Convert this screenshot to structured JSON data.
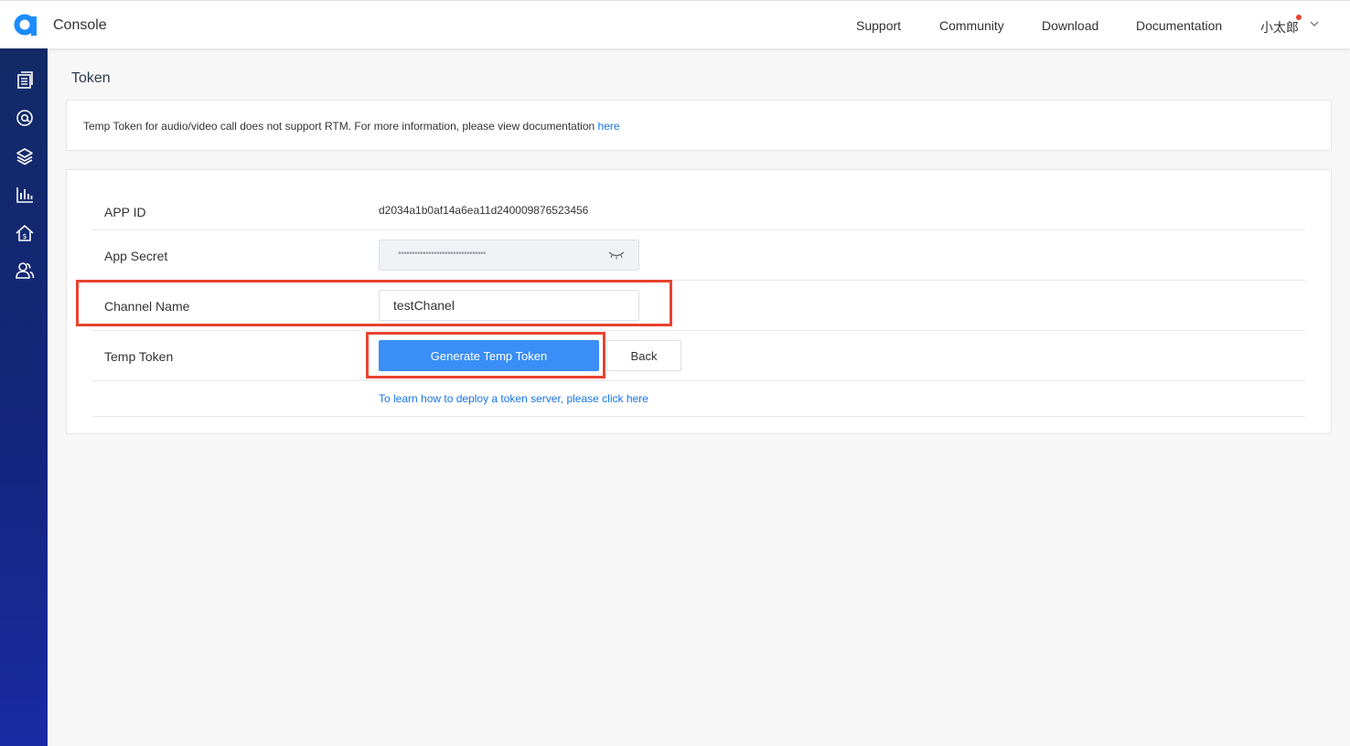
{
  "header": {
    "brand": "Console",
    "nav": [
      {
        "label": "Support"
      },
      {
        "label": "Community"
      },
      {
        "label": "Download"
      },
      {
        "label": "Documentation"
      }
    ],
    "user_name": "小太郎"
  },
  "sidebar": {
    "icons": [
      "projects-icon",
      "at-icon",
      "layers-icon",
      "chart-icon",
      "billing-home-icon",
      "users-icon"
    ]
  },
  "page": {
    "title": "Token"
  },
  "notice": {
    "text": "Temp Token for audio/video call does not support RTM. For more information, please view documentation ",
    "link": "here"
  },
  "form": {
    "app_id_label": "APP ID",
    "app_id_value": "d2034a1b0af14a6ea11d240009876523456",
    "app_secret_label": "App Secret",
    "app_secret_mask": "••••••••••••••••••••••••••••••••",
    "channel_label": "Channel Name",
    "channel_value": "testChanel",
    "temp_token_label": "Temp Token",
    "generate_button": "Generate Temp Token",
    "back_button": "Back",
    "learn_link": "To learn how to deploy a token server, please click here"
  },
  "colors": {
    "accent": "#3a8ef6",
    "link": "#1874e8",
    "highlight": "#e8432e",
    "sidebar": "#14257c"
  }
}
